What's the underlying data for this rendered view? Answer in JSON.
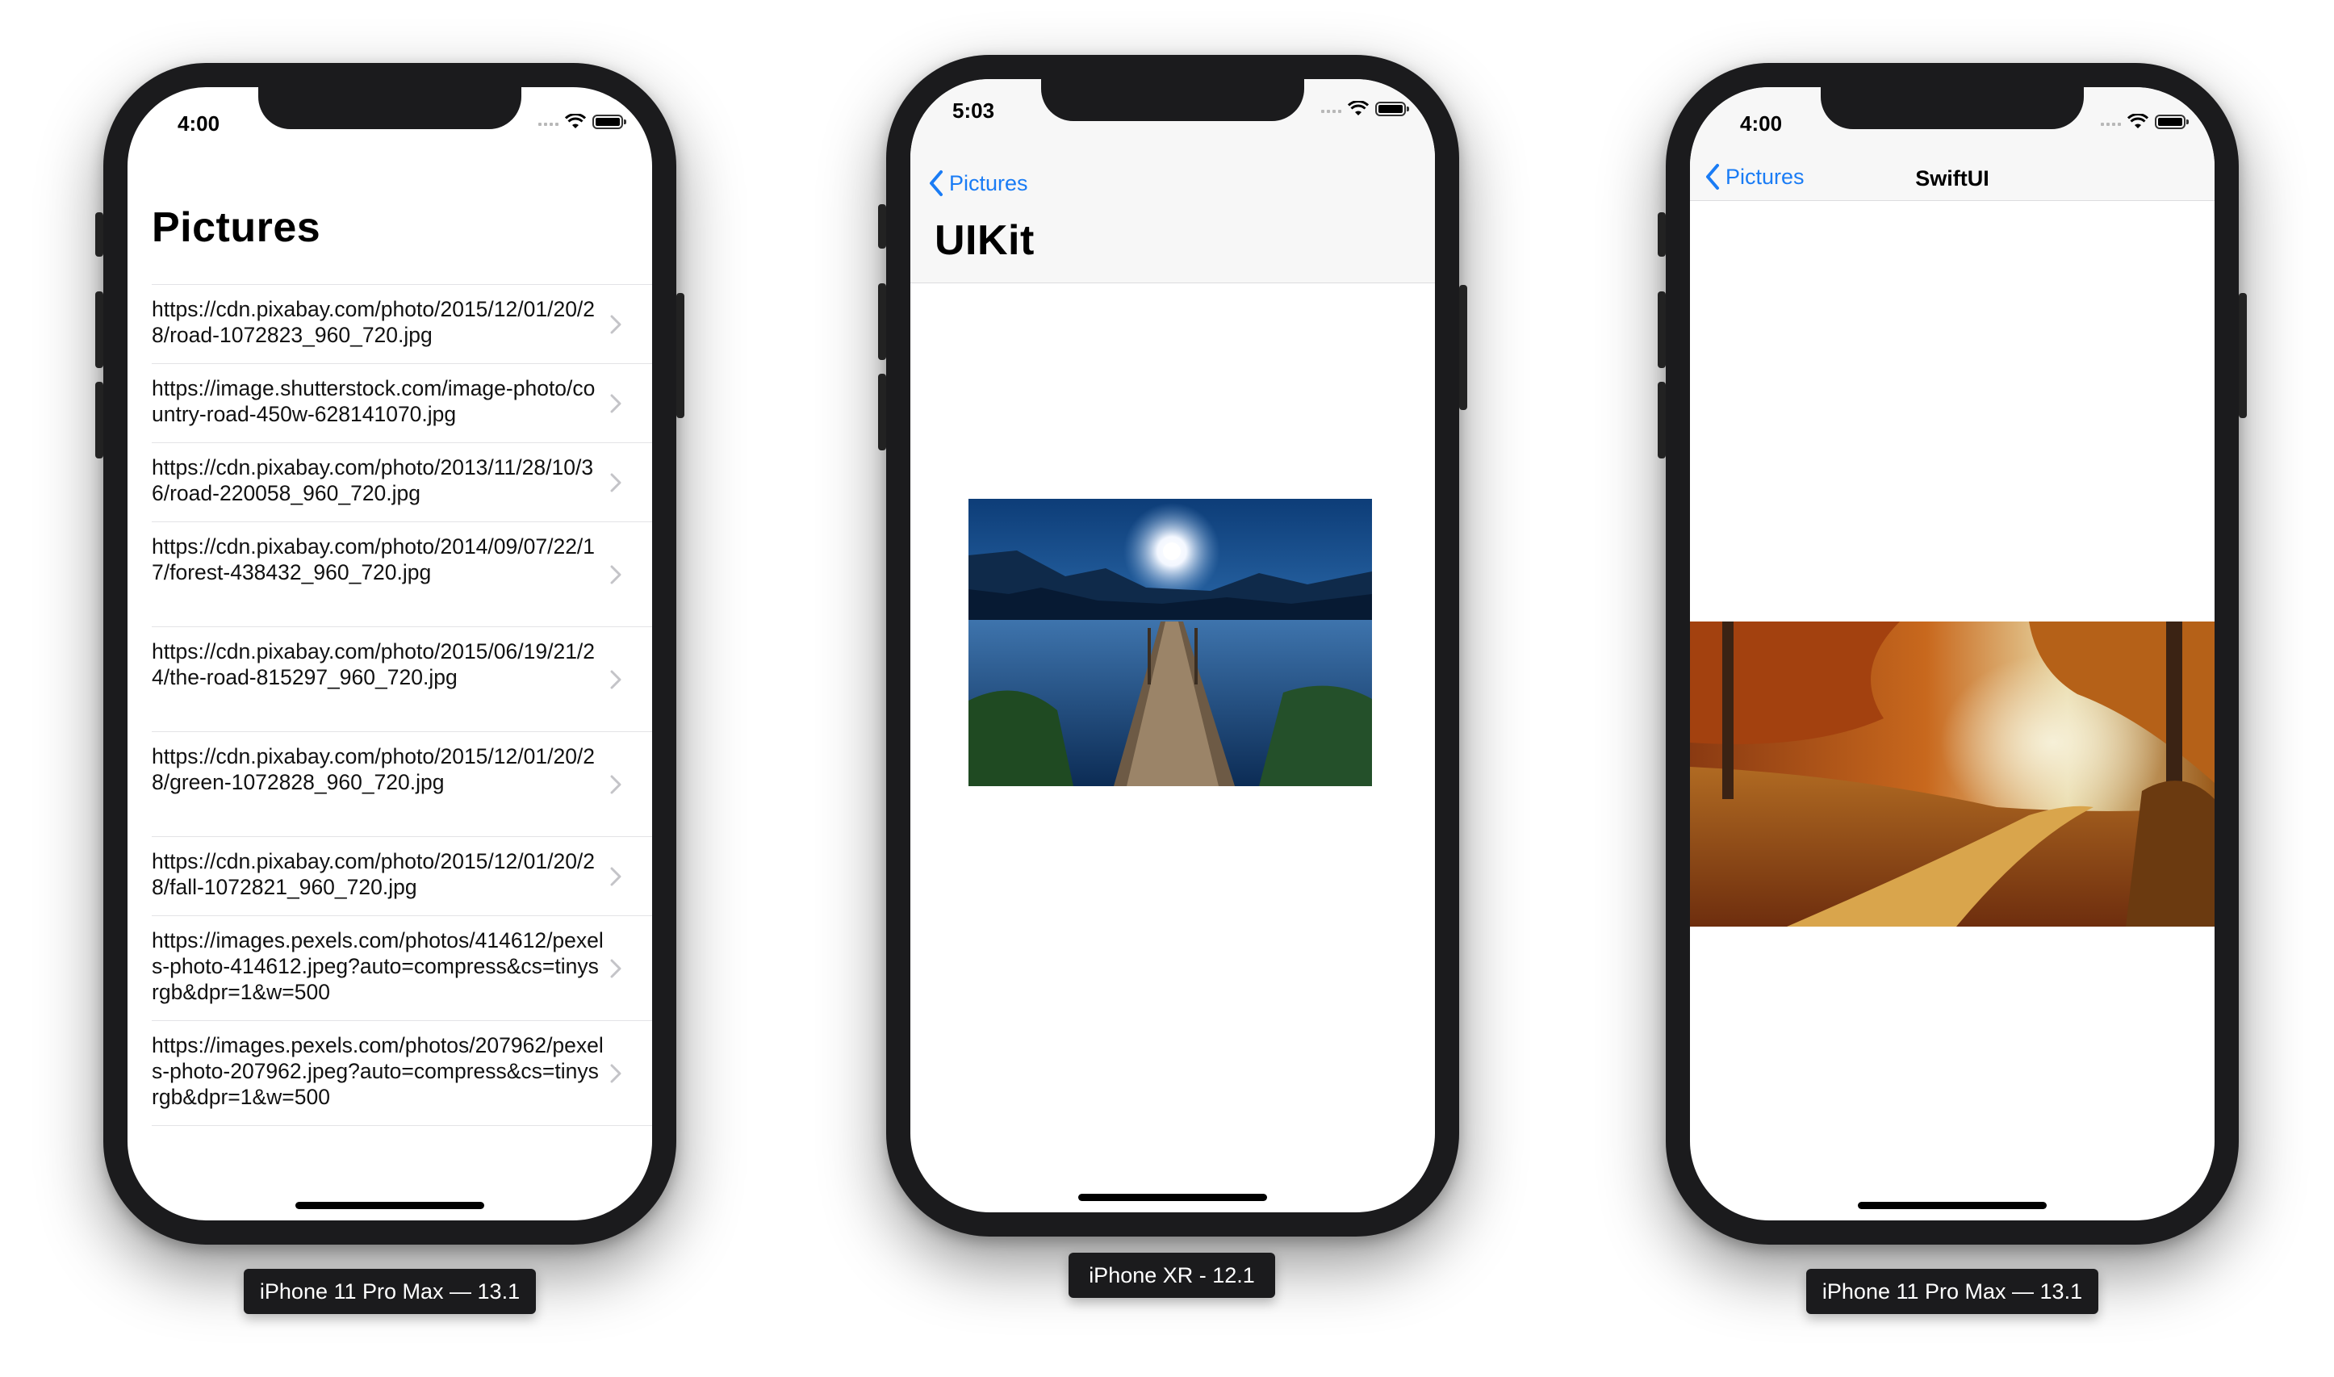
{
  "phones": {
    "left": {
      "caption": "iPhone 11 Pro Max — 13.1",
      "status_time": "4:00",
      "title": "Pictures",
      "items": [
        {
          "url": "https://cdn.pixabay.com/photo/2015/12/01/20/28/road-1072823_960_720.jpg"
        },
        {
          "url": "https://image.shutterstock.com/image-photo/country-road-450w-628141070.jpg"
        },
        {
          "url": "https://cdn.pixabay.com/photo/2013/11/28/10/36/road-220058_960_720.jpg"
        },
        {
          "url": "https://cdn.pixabay.com/photo/2014/09/07/22/17/forest-438432_960_720.jpg"
        },
        {
          "url": "https://cdn.pixabay.com/photo/2015/06/19/21/24/the-road-815297_960_720.jpg"
        },
        {
          "url": "https://cdn.pixabay.com/photo/2015/12/01/20/28/green-1072828_960_720.jpg"
        },
        {
          "url": "https://cdn.pixabay.com/photo/2015/12/01/20/28/fall-1072821_960_720.jpg"
        },
        {
          "url": "https://images.pexels.com/photos/414612/pexels-photo-414612.jpeg?auto=compress&cs=tinysrgb&dpr=1&w=500"
        },
        {
          "url": "https://images.pexels.com/photos/207962/pexels-photo-207962.jpeg?auto=compress&cs=tinysrgb&dpr=1&w=500"
        }
      ]
    },
    "middle": {
      "caption": "iPhone XR - 12.1",
      "status_time": "5:03",
      "back_label": "Pictures",
      "title": "UIKit"
    },
    "right": {
      "caption": "iPhone 11 Pro Max — 13.1",
      "status_time": "4:00",
      "back_label": "Pictures",
      "title": "SwiftUI"
    }
  },
  "colors": {
    "accent": "#1a7cf5",
    "device_frame": "#1b1b1d",
    "caption_bg": "#1b1b1d",
    "separator": "#e3e3e6"
  },
  "icons": [
    "chevron-right-icon",
    "chevron-left-icon",
    "wifi-icon",
    "battery-icon",
    "cellular-signal-icon"
  ]
}
